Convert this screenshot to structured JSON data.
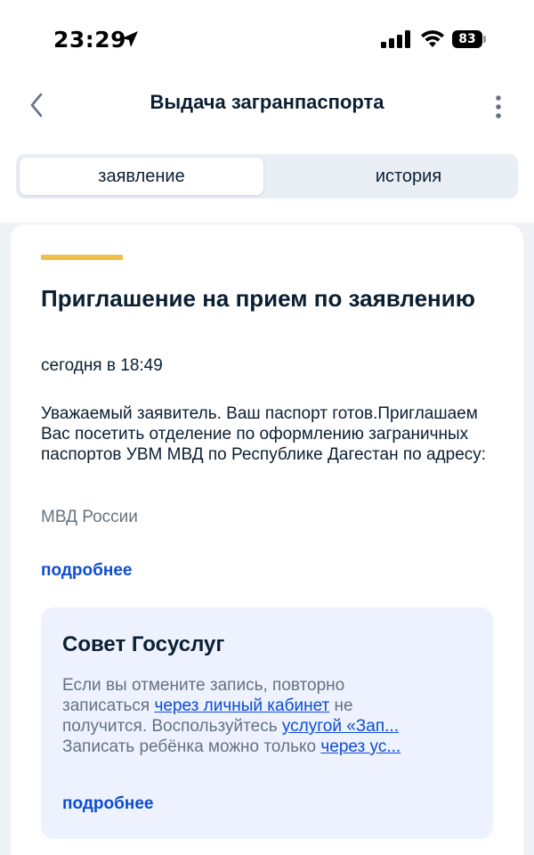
{
  "status_bar": {
    "time": "23:29",
    "battery": "83"
  },
  "header": {
    "title": "Выдача загранпаспорта"
  },
  "tabs": [
    {
      "label": "заявление",
      "active": true
    },
    {
      "label": "история",
      "active": false
    }
  ],
  "card": {
    "accent_color": "#edc04a",
    "title": "Приглашение на прием по заявлению",
    "date": "сегодня в 18:49",
    "message": "Уважаемый заявитель. Ваш паспорт готов.Приглашаем Вас посетить отделение по оформлению заграничных паспортов УВМ МВД по Республике Дагестан по адресу:",
    "source": "МВД России",
    "more_label": "подробнее"
  },
  "advice": {
    "title": "Совет Госуслуг",
    "line1": "Если вы отмените запись, повторно",
    "line2_pre": "записаться ",
    "link1": "через личный кабинет",
    "line2_post": " не",
    "line3_pre": "получится. Воспользуйтесь ",
    "link2": "услугой «Зап...",
    "line4_pre": "Записать ребёнка можно только ",
    "link3": "через ус...",
    "more_label": "подробнее"
  },
  "colors": {
    "link": "#0d4cd3",
    "text": "#0b1f33",
    "secondary_text": "#66727f",
    "advice_bg": "#edf2fe"
  },
  "icons": [
    "location-arrow-icon",
    "cellular-signal-icon",
    "wifi-icon",
    "battery-icon",
    "chevron-left-icon",
    "more-vertical-icon"
  ]
}
